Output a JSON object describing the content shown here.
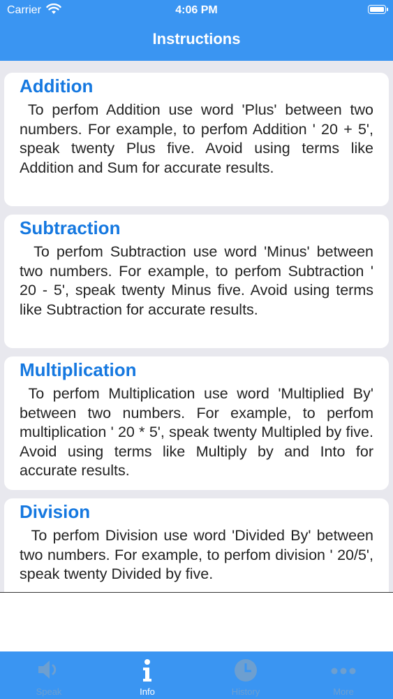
{
  "status_bar": {
    "carrier": "Carrier",
    "time": "4:06 PM"
  },
  "nav": {
    "title": "Instructions"
  },
  "cards": [
    {
      "title": "Addition",
      "body": "To perfom Addition use word 'Plus' between two numbers. For example, to perfom Addition ' 20 + 5', speak twenty Plus five. Avoid using terms like Addition and Sum for accurate results."
    },
    {
      "title": "Subtraction",
      "body": "To perfom Subtraction use word 'Minus' between two numbers. For example, to perfom Subtraction ' 20 - 5', speak twenty Minus five. Avoid using terms like Subtraction for accurate results."
    },
    {
      "title": "Multiplication",
      "body": "To perfom Multiplication use word 'Multiplied By' between two numbers. For example, to perfom multiplication ' 20 * 5', speak twenty Multipled by five. Avoid using terms like Multiply by and Into for accurate results."
    },
    {
      "title": "Division",
      "body": "To perfom Division use word 'Divided By' between two numbers. For example, to perfom division ' 20/5', speak twenty Divided by five."
    }
  ],
  "tabs": [
    {
      "label": "Speak",
      "icon": "speaker-icon",
      "active": false
    },
    {
      "label": "Info",
      "icon": "info-icon",
      "active": true
    },
    {
      "label": "History",
      "icon": "clock-icon",
      "active": false
    },
    {
      "label": "More",
      "icon": "more-icon",
      "active": false
    }
  ],
  "colors": {
    "bar": "#3a95f2",
    "title_blue": "#1578e0",
    "background": "#e8e8ee"
  }
}
